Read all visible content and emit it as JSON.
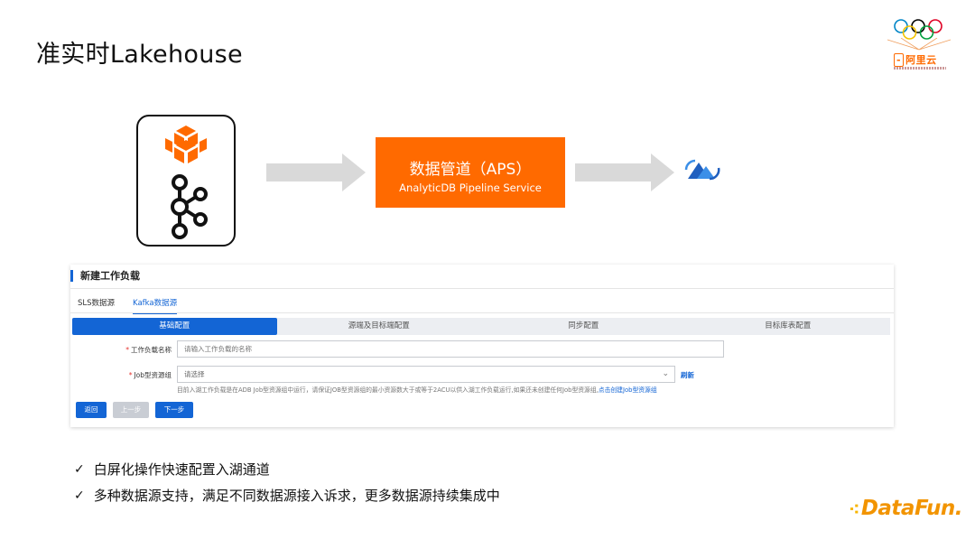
{
  "slide": {
    "title": "准实时Lakehouse"
  },
  "brand": {
    "logo_text": "阿里云",
    "footer_logo": "DataFun.",
    "accent": "#ff6a00",
    "footer_accent": "#f29400"
  },
  "diagram": {
    "source_icons": [
      "sls-cube-icon",
      "kafka-icon"
    ],
    "pipeline": {
      "title": "数据管道（APS）",
      "subtitle": "AnalyticDB Pipeline Service",
      "color": "#ff6a00"
    },
    "target_icon": "lakehouse-mountain-icon"
  },
  "form": {
    "title": "新建工作负载",
    "source_tabs": [
      {
        "label": "SLS数据源",
        "active": false
      },
      {
        "label": "Kafka数据源",
        "active": true
      }
    ],
    "steps": [
      {
        "label": "基础配置",
        "active": true
      },
      {
        "label": "源端及目标端配置",
        "active": false
      },
      {
        "label": "同步配置",
        "active": false
      },
      {
        "label": "目标库表配置",
        "active": false
      }
    ],
    "workload_name": {
      "required_mark": "*",
      "label": "工作负载名称",
      "placeholder": "请输入工作负载的名称",
      "value": ""
    },
    "resource_group": {
      "required_mark": "*",
      "label": "Job型资源组",
      "value": "请选择",
      "refresh_label": "刷新"
    },
    "hint": "目前入湖工作负载是在ADB Job型资源组中运行，请保证JOB型资源组的最小资源数大于或等于2ACU以供入湖工作负载运行,如果还未创建任何Job型资源组,",
    "hint_link": "点击创建Job型资源组",
    "buttons": {
      "back": "返回",
      "prev": "上一步",
      "next": "下一步"
    },
    "primary_color": "#1365d5"
  },
  "bullets": [
    "白屏化操作快速配置入湖通道",
    "多种数据源支持，满足不同数据源接入诉求，更多数据源持续集成中"
  ]
}
